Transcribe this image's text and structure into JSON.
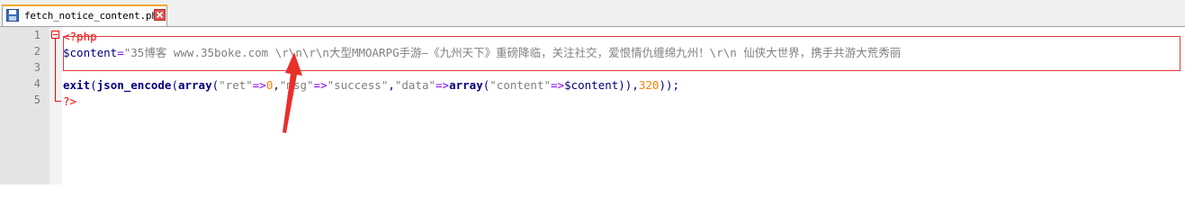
{
  "tab": {
    "filename": "fetch_notice_content.php",
    "icons": {
      "file": "save-disk-icon",
      "close": "close-icon"
    }
  },
  "editor": {
    "line_numbers": [
      "1",
      "2",
      "3",
      "4",
      "5"
    ],
    "lines": [
      [
        {
          "t": "<?php",
          "c": "tag"
        }
      ],
      [
        {
          "t": "$content",
          "c": "var"
        },
        {
          "t": "=",
          "c": "op"
        },
        {
          "t": "\"35博客 www.35boke.com \\r\\n\\r\\n大型MMOARPG手游—《九州天下》重磅降临，关注社交，爱恨情仇缠绵九州！\\r\\n 仙侠大世界，携手共游大荒秀丽",
          "c": "str"
        }
      ],
      [],
      [
        {
          "t": "exit",
          "c": "fn"
        },
        {
          "t": "(",
          "c": "punc"
        },
        {
          "t": "json_encode",
          "c": "fn"
        },
        {
          "t": "(",
          "c": "punc"
        },
        {
          "t": "array",
          "c": "fn"
        },
        {
          "t": "(",
          "c": "punc"
        },
        {
          "t": "\"ret\"",
          "c": "str"
        },
        {
          "t": "=>",
          "c": "op"
        },
        {
          "t": "0",
          "c": "num"
        },
        {
          "t": ",",
          "c": "punc"
        },
        {
          "t": "\"msg\"",
          "c": "str"
        },
        {
          "t": "=>",
          "c": "op"
        },
        {
          "t": "\"success\"",
          "c": "str"
        },
        {
          "t": ",",
          "c": "punc"
        },
        {
          "t": "\"data\"",
          "c": "str"
        },
        {
          "t": "=>",
          "c": "op"
        },
        {
          "t": "array",
          "c": "fn"
        },
        {
          "t": "(",
          "c": "punc"
        },
        {
          "t": "\"content\"",
          "c": "str"
        },
        {
          "t": "=>",
          "c": "op"
        },
        {
          "t": "$content",
          "c": "var"
        },
        {
          "t": ")),",
          "c": "punc"
        },
        {
          "t": "320",
          "c": "num"
        },
        {
          "t": "));",
          "c": "punc"
        }
      ],
      [
        {
          "t": "?>",
          "c": "tag"
        }
      ]
    ]
  },
  "annotations": {
    "highlight_color": "#e23a3a",
    "arrow_color": "#e8302b"
  },
  "colors": {
    "tag": "#ff0000",
    "var": "#000080",
    "operator": "#8000ff",
    "string": "#808080",
    "number": "#ff8000"
  }
}
